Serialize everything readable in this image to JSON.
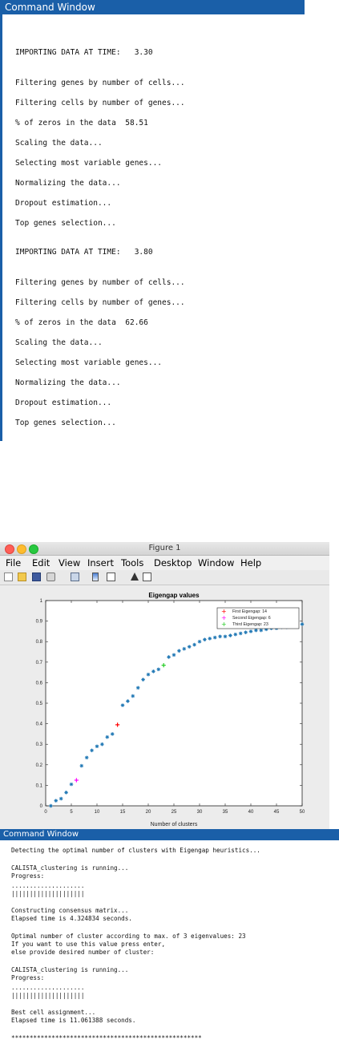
{
  "command_window_1": {
    "title": "Command Window",
    "lines": [
      "IMPORTING DATA AT TIME:   3.30",
      "Filtering genes by number of cells...",
      "Filtering cells by number of genes...",
      "% of zeros in the data  58.51",
      "Scaling the data...",
      "Selecting most variable genes...",
      "Normalizing the data...",
      "Dropout estimation...",
      "Top genes selection...",
      "IMPORTING DATA AT TIME:   3.80",
      "Filtering genes by number of cells...",
      "Filtering cells by number of genes...",
      "% of zeros in the data  62.66",
      "Scaling the data...",
      "Selecting most variable genes...",
      "Normalizing the data...",
      "Dropout estimation...",
      "Top genes selection..."
    ]
  },
  "figure": {
    "title": "Figure 1",
    "menu": [
      "File",
      "Edit",
      "View",
      "Insert",
      "Tools",
      "Desktop",
      "Window",
      "Help"
    ],
    "toolbar_icons": [
      "new-figure-icon",
      "open-file-icon",
      "save-icon",
      "print-icon",
      "link-plot-icon",
      "insert-colorbar-icon",
      "insert-legend-icon",
      "edit-plot-icon",
      "plot-browser-icon"
    ]
  },
  "chart_data": {
    "type": "scatter",
    "title": "Eigengap values",
    "xlabel": "Number of clusters",
    "ylabel": "",
    "xlim": [
      0,
      50
    ],
    "ylim": [
      0,
      1
    ],
    "xticks": [
      0,
      5,
      10,
      15,
      20,
      25,
      30,
      35,
      40,
      45,
      50
    ],
    "yticks": [
      0,
      0.1,
      0.2,
      0.3,
      0.4,
      0.5,
      0.6,
      0.7,
      0.8,
      0.9,
      1
    ],
    "grid": false,
    "legend_position": "top-right",
    "series": [
      {
        "name": "",
        "marker": "*",
        "color": "#1f77b4",
        "x": [
          1,
          2,
          3,
          4,
          5,
          7,
          8,
          9,
          10,
          11,
          12,
          13,
          15,
          16,
          17,
          18,
          19,
          20,
          21,
          22,
          24,
          25,
          26,
          27,
          28,
          29,
          30,
          31,
          32,
          33,
          34,
          35,
          36,
          37,
          38,
          39,
          40,
          41,
          42,
          43,
          44,
          45,
          46,
          47,
          48,
          49,
          50
        ],
        "y": [
          0.0,
          0.025,
          0.035,
          0.065,
          0.105,
          0.195,
          0.235,
          0.27,
          0.29,
          0.3,
          0.335,
          0.35,
          0.49,
          0.51,
          0.535,
          0.575,
          0.615,
          0.64,
          0.655,
          0.665,
          0.725,
          0.735,
          0.755,
          0.765,
          0.775,
          0.785,
          0.8,
          0.81,
          0.815,
          0.82,
          0.825,
          0.825,
          0.83,
          0.835,
          0.84,
          0.845,
          0.85,
          0.855,
          0.855,
          0.86,
          0.865,
          0.865,
          0.87,
          0.87,
          0.88,
          0.885,
          0.885
        ]
      },
      {
        "name": "First Eigengap:   14",
        "marker": "+",
        "color": "#ff0000",
        "x": [
          14
        ],
        "y": [
          0.395
        ]
      },
      {
        "name": "Second Eigengap:   6",
        "marker": "+",
        "color": "#ff00ff",
        "x": [
          6
        ],
        "y": [
          0.125
        ]
      },
      {
        "name": "Third Eigengap:   23",
        "marker": "+",
        "color": "#22cc22",
        "x": [
          23
        ],
        "y": [
          0.685
        ]
      }
    ]
  },
  "command_window_2": {
    "title": "Command Window",
    "lines": [
      "Detecting the optimal number of clusters with Eigengap heuristics...",
      "CALISTA_clustering is running...",
      "Progress:",
      "....................",
      "||||||||||||||||||||",
      "Constructing consensus matrix...",
      "Elapsed time is 4.324834 seconds.",
      "Optimal number of cluster according to max. of 3 eigenvalues: 23",
      "If you want to use this value press enter,",
      "else provide desired number of cluster:",
      "CALISTA_clustering is running...",
      "Progress:",
      "....................",
      "||||||||||||||||||||",
      "Best cell assignment...",
      "Elapsed time is 11.061388 seconds.",
      "****************************************************"
    ]
  }
}
